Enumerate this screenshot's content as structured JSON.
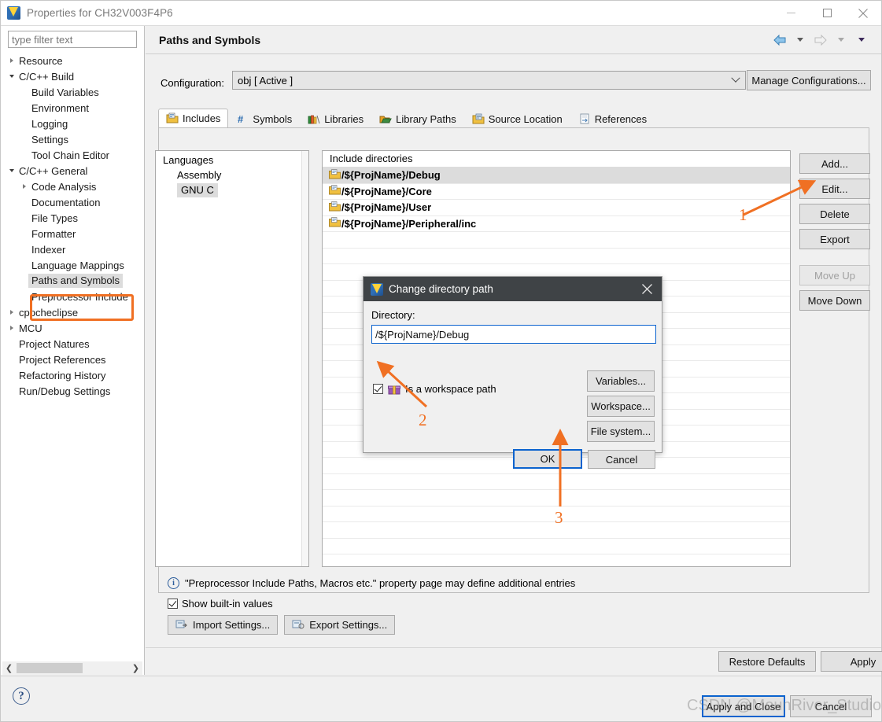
{
  "window": {
    "title": "Properties for CH32V003F4P6",
    "logo_icon": "mounriver-logo-icon",
    "minimize_label": "Minimize",
    "maximize_label": "Maximize",
    "close_label": "Close"
  },
  "sidebar": {
    "filter_placeholder": "type filter text",
    "filter_value": "",
    "items": [
      {
        "label": "Resource",
        "indent": 0,
        "twisty": "collapsed",
        "selected": false
      },
      {
        "label": "C/C++ Build",
        "indent": 0,
        "twisty": "expanded",
        "selected": false
      },
      {
        "label": "Build Variables",
        "indent": 1,
        "twisty": "none",
        "selected": false
      },
      {
        "label": "Environment",
        "indent": 1,
        "twisty": "none",
        "selected": false
      },
      {
        "label": "Logging",
        "indent": 1,
        "twisty": "none",
        "selected": false
      },
      {
        "label": "Settings",
        "indent": 1,
        "twisty": "none",
        "selected": false
      },
      {
        "label": "Tool Chain Editor",
        "indent": 1,
        "twisty": "none",
        "selected": false
      },
      {
        "label": "C/C++ General",
        "indent": 0,
        "twisty": "expanded",
        "selected": false
      },
      {
        "label": "Code Analysis",
        "indent": 1,
        "twisty": "collapsed",
        "selected": false
      },
      {
        "label": "Documentation",
        "indent": 1,
        "twisty": "none",
        "selected": false
      },
      {
        "label": "File Types",
        "indent": 1,
        "twisty": "none",
        "selected": false
      },
      {
        "label": "Formatter",
        "indent": 1,
        "twisty": "none",
        "selected": false
      },
      {
        "label": "Indexer",
        "indent": 1,
        "twisty": "none",
        "selected": false
      },
      {
        "label": "Language Mappings",
        "indent": 1,
        "twisty": "none",
        "selected": false
      },
      {
        "label": "Paths and Symbols",
        "indent": 1,
        "twisty": "none",
        "selected": true
      },
      {
        "label": "Preprocessor Include",
        "indent": 1,
        "twisty": "none",
        "selected": false
      },
      {
        "label": "cppcheclipse",
        "indent": 0,
        "twisty": "collapsed",
        "selected": false
      },
      {
        "label": "MCU",
        "indent": 0,
        "twisty": "collapsed",
        "selected": false
      },
      {
        "label": "Project Natures",
        "indent": 0,
        "twisty": "none",
        "selected": false
      },
      {
        "label": "Project References",
        "indent": 0,
        "twisty": "none",
        "selected": false
      },
      {
        "label": "Refactoring History",
        "indent": 0,
        "twisty": "none",
        "selected": false
      },
      {
        "label": "Run/Debug Settings",
        "indent": 0,
        "twisty": "none",
        "selected": false
      }
    ]
  },
  "page": {
    "title": "Paths and Symbols",
    "nav_back_icon": "back-arrow-icon",
    "nav_forward_icon": "forward-arrow-icon",
    "nav_menu_icon": "chevron-down-icon"
  },
  "configuration": {
    "label": "Configuration:",
    "value": "obj  [ Active ]",
    "manage_button": "Manage Configurations..."
  },
  "tabs": [
    {
      "label": "Includes",
      "icon": "includes-folder-icon",
      "active": true
    },
    {
      "label": "Symbols",
      "icon": "hash-icon",
      "active": false
    },
    {
      "label": "Libraries",
      "icon": "books-icon",
      "active": false
    },
    {
      "label": "Library Paths",
      "icon": "open-folder-icon",
      "active": false
    },
    {
      "label": "Source Location",
      "icon": "source-folder-icon",
      "active": false
    },
    {
      "label": "References",
      "icon": "references-page-icon",
      "active": false
    }
  ],
  "languages": {
    "header": "Languages",
    "items": [
      {
        "label": "Assembly",
        "selected": false
      },
      {
        "label": "GNU C",
        "selected": true
      }
    ]
  },
  "include_directories": {
    "header": "Include directories",
    "rows": [
      {
        "path": "/${ProjName}/Debug",
        "selected": true
      },
      {
        "path": "/${ProjName}/Core",
        "selected": false
      },
      {
        "path": "/${ProjName}/User",
        "selected": false
      },
      {
        "path": "/${ProjName}/Peripheral/inc",
        "selected": false
      }
    ]
  },
  "side_buttons": [
    {
      "label": "Add...",
      "enabled": true
    },
    {
      "label": "Edit...",
      "enabled": true
    },
    {
      "label": "Delete",
      "enabled": true
    },
    {
      "label": "Export",
      "enabled": true
    },
    {
      "label": "Move Up",
      "enabled": false
    },
    {
      "label": "Move Down",
      "enabled": true
    }
  ],
  "footer": {
    "note": "\"Preprocessor Include Paths, Macros etc.\" property page may define additional entries",
    "note_icon": "info-icon",
    "show_builtin_label": "Show built-in values",
    "show_builtin_checked": true,
    "import_settings": "Import Settings...",
    "export_settings": "Export Settings...",
    "restore_defaults": "Restore Defaults",
    "apply": "Apply",
    "apply_and_close": "Apply and Close",
    "cancel": "Cancel",
    "help_icon": "help-icon"
  },
  "dialog": {
    "title": "Change directory path",
    "title_icon": "mounriver-logo-icon",
    "close_icon": "close-icon",
    "directory_label": "Directory:",
    "directory_value": "/${ProjName}/Debug",
    "workspace_checkbox_label": "Is a workspace path",
    "workspace_checkbox_checked": true,
    "workspace_icon": "workspace-box-icon",
    "buttons": {
      "variables": "Variables...",
      "workspace": "Workspace...",
      "file_system": "File system...",
      "ok": "OK",
      "cancel": "Cancel"
    }
  },
  "annotations": {
    "color": "#f07023",
    "markers": [
      {
        "number": "1",
        "points_to": "edit-button"
      },
      {
        "number": "2",
        "points_to": "workspace-path-checkbox"
      },
      {
        "number": "3",
        "points_to": "dialog-ok-button"
      }
    ],
    "highlight_target": "sidebar-item-paths-and-symbols"
  },
  "watermark": {
    "text": "CSDN @MounRiver_Studio"
  }
}
